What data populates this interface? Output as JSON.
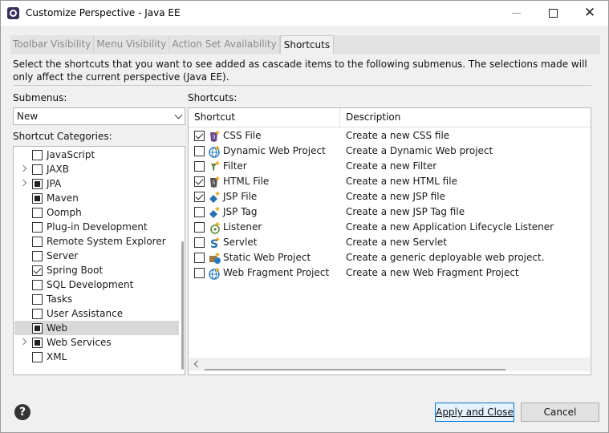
{
  "window": {
    "title": "Customize Perspective - Java EE",
    "minimize_icon": "minimize-icon",
    "maximize_icon": "maximize-icon",
    "close_icon": "close-icon"
  },
  "tabs": [
    {
      "label": "Toolbar Visibility",
      "active": false
    },
    {
      "label": "Menu Visibility",
      "active": false
    },
    {
      "label": "Action Set Availability",
      "active": false
    },
    {
      "label": "Shortcuts",
      "active": true
    }
  ],
  "description": "Select the shortcuts that you want to see added as cascade items to the following submenus.  The selections made will only affect the current perspective (Java EE).",
  "submenus": {
    "label": "Submenus:",
    "selected": "New"
  },
  "categories": {
    "label": "Shortcut Categories:",
    "items": [
      {
        "label": "JavaScript",
        "state": "unchecked",
        "expandable": false,
        "selected": false
      },
      {
        "label": "JAXB",
        "state": "unchecked",
        "expandable": true,
        "selected": false
      },
      {
        "label": "JPA",
        "state": "partial",
        "expandable": true,
        "selected": false
      },
      {
        "label": "Maven",
        "state": "partial",
        "expandable": false,
        "selected": false
      },
      {
        "label": "Oomph",
        "state": "unchecked",
        "expandable": false,
        "selected": false
      },
      {
        "label": "Plug-in Development",
        "state": "unchecked",
        "expandable": false,
        "selected": false
      },
      {
        "label": "Remote System Explorer",
        "state": "unchecked",
        "expandable": false,
        "selected": false
      },
      {
        "label": "Server",
        "state": "unchecked",
        "expandable": false,
        "selected": false
      },
      {
        "label": "Spring Boot",
        "state": "checked",
        "expandable": false,
        "selected": false
      },
      {
        "label": "SQL Development",
        "state": "unchecked",
        "expandable": false,
        "selected": false
      },
      {
        "label": "Tasks",
        "state": "unchecked",
        "expandable": false,
        "selected": false
      },
      {
        "label": "User Assistance",
        "state": "unchecked",
        "expandable": false,
        "selected": false
      },
      {
        "label": "Web",
        "state": "partial",
        "expandable": false,
        "selected": true
      },
      {
        "label": "Web Services",
        "state": "partial",
        "expandable": true,
        "selected": false
      },
      {
        "label": "XML",
        "state": "unchecked",
        "expandable": false,
        "selected": false
      }
    ]
  },
  "shortcuts": {
    "label": "Shortcuts:",
    "columns": [
      "Shortcut",
      "Description"
    ],
    "rows": [
      {
        "name": "CSS File",
        "description": "Create a new CSS file",
        "checked": true,
        "icon": "css-file-icon",
        "color": "#6a4a8a"
      },
      {
        "name": "Dynamic Web Project",
        "description": "Create a Dynamic Web project",
        "checked": false,
        "icon": "dynamic-web-project-icon",
        "color": "#2a7bc0"
      },
      {
        "name": "Filter",
        "description": "Create a new Filter",
        "checked": false,
        "icon": "filter-icon",
        "color": "#5a8a3a"
      },
      {
        "name": "HTML File",
        "description": "Create a new HTML file",
        "checked": true,
        "icon": "html-file-icon",
        "color": "#555555"
      },
      {
        "name": "JSP File",
        "description": "Create a new JSP file",
        "checked": true,
        "icon": "jsp-file-icon",
        "color": "#2a6fb0"
      },
      {
        "name": "JSP Tag",
        "description": "Create a new JSP Tag file",
        "checked": false,
        "icon": "jsp-tag-icon",
        "color": "#2a6fb0"
      },
      {
        "name": "Listener",
        "description": "Create a new Application Lifecycle Listener",
        "checked": false,
        "icon": "listener-icon",
        "color": "#5a8a3a"
      },
      {
        "name": "Servlet",
        "description": "Create a new Servlet",
        "checked": false,
        "icon": "servlet-icon",
        "color": "#2a6fb0"
      },
      {
        "name": "Static Web Project",
        "description": "Create a generic deployable web project.",
        "checked": false,
        "icon": "static-web-project-icon",
        "color": "#a07a3a"
      },
      {
        "name": "Web Fragment Project",
        "description": "Create a new Web Fragment Project",
        "checked": false,
        "icon": "web-fragment-project-icon",
        "color": "#2a7bc0"
      }
    ]
  },
  "footer": {
    "help_icon": "help-icon",
    "apply_label": "Apply and Close",
    "cancel_label": "Cancel"
  }
}
